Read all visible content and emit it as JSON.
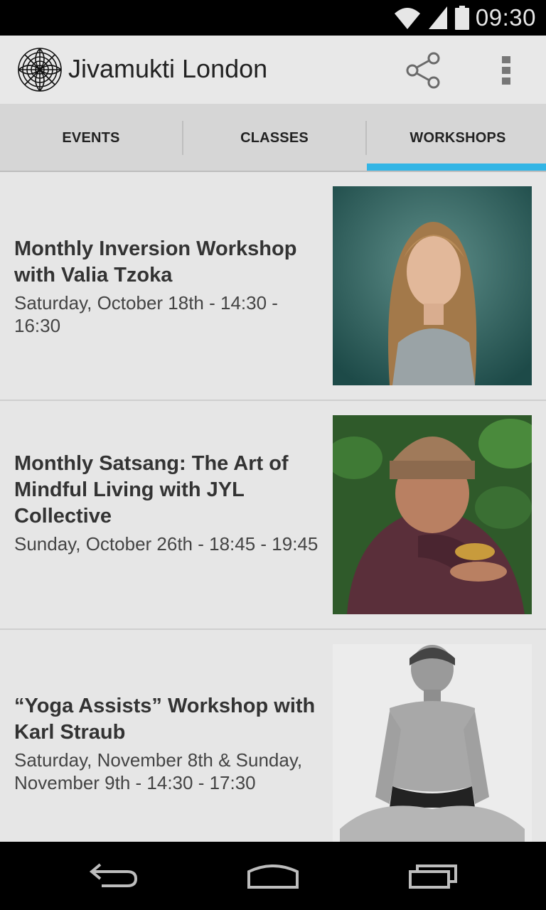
{
  "status_bar": {
    "time": "09:30",
    "icons": [
      "wifi-icon",
      "signal-icon",
      "battery-icon"
    ]
  },
  "action_bar": {
    "title": "Jivamukti London",
    "icons": [
      "logo-mandala-icon",
      "share-icon",
      "overflow-menu-icon"
    ]
  },
  "tabs": [
    {
      "label": "EVENTS",
      "selected": false
    },
    {
      "label": "CLASSES",
      "selected": false
    },
    {
      "label": "WORKSHOPS",
      "selected": true
    }
  ],
  "colors": {
    "accent": "#33b5e5",
    "background": "#e6e6e6",
    "tab_background": "#d6d6d6",
    "text": "#333333"
  },
  "workshops": [
    {
      "title": "Monthly Inversion Workshop with Valia Tzoka",
      "date": "Saturday, October 18th - 14:30 - 16:30",
      "image": "portrait-woman-teal-background"
    },
    {
      "title": "Monthly Satsang: The Art of Mindful Living with JYL Collective",
      "date": "Sunday, October 26th - 18:45 - 19:45",
      "image": "monk-with-singing-bowl"
    },
    {
      "title": "“Yoga Assists” Workshop with Karl Straub",
      "date": "Saturday, November 8th & Sunday, November 9th - 14:30 - 17:30",
      "image": "man-seated-lotus-pose-bw"
    }
  ],
  "nav_bar": {
    "icons": [
      "back-icon",
      "home-icon",
      "recents-icon"
    ]
  }
}
